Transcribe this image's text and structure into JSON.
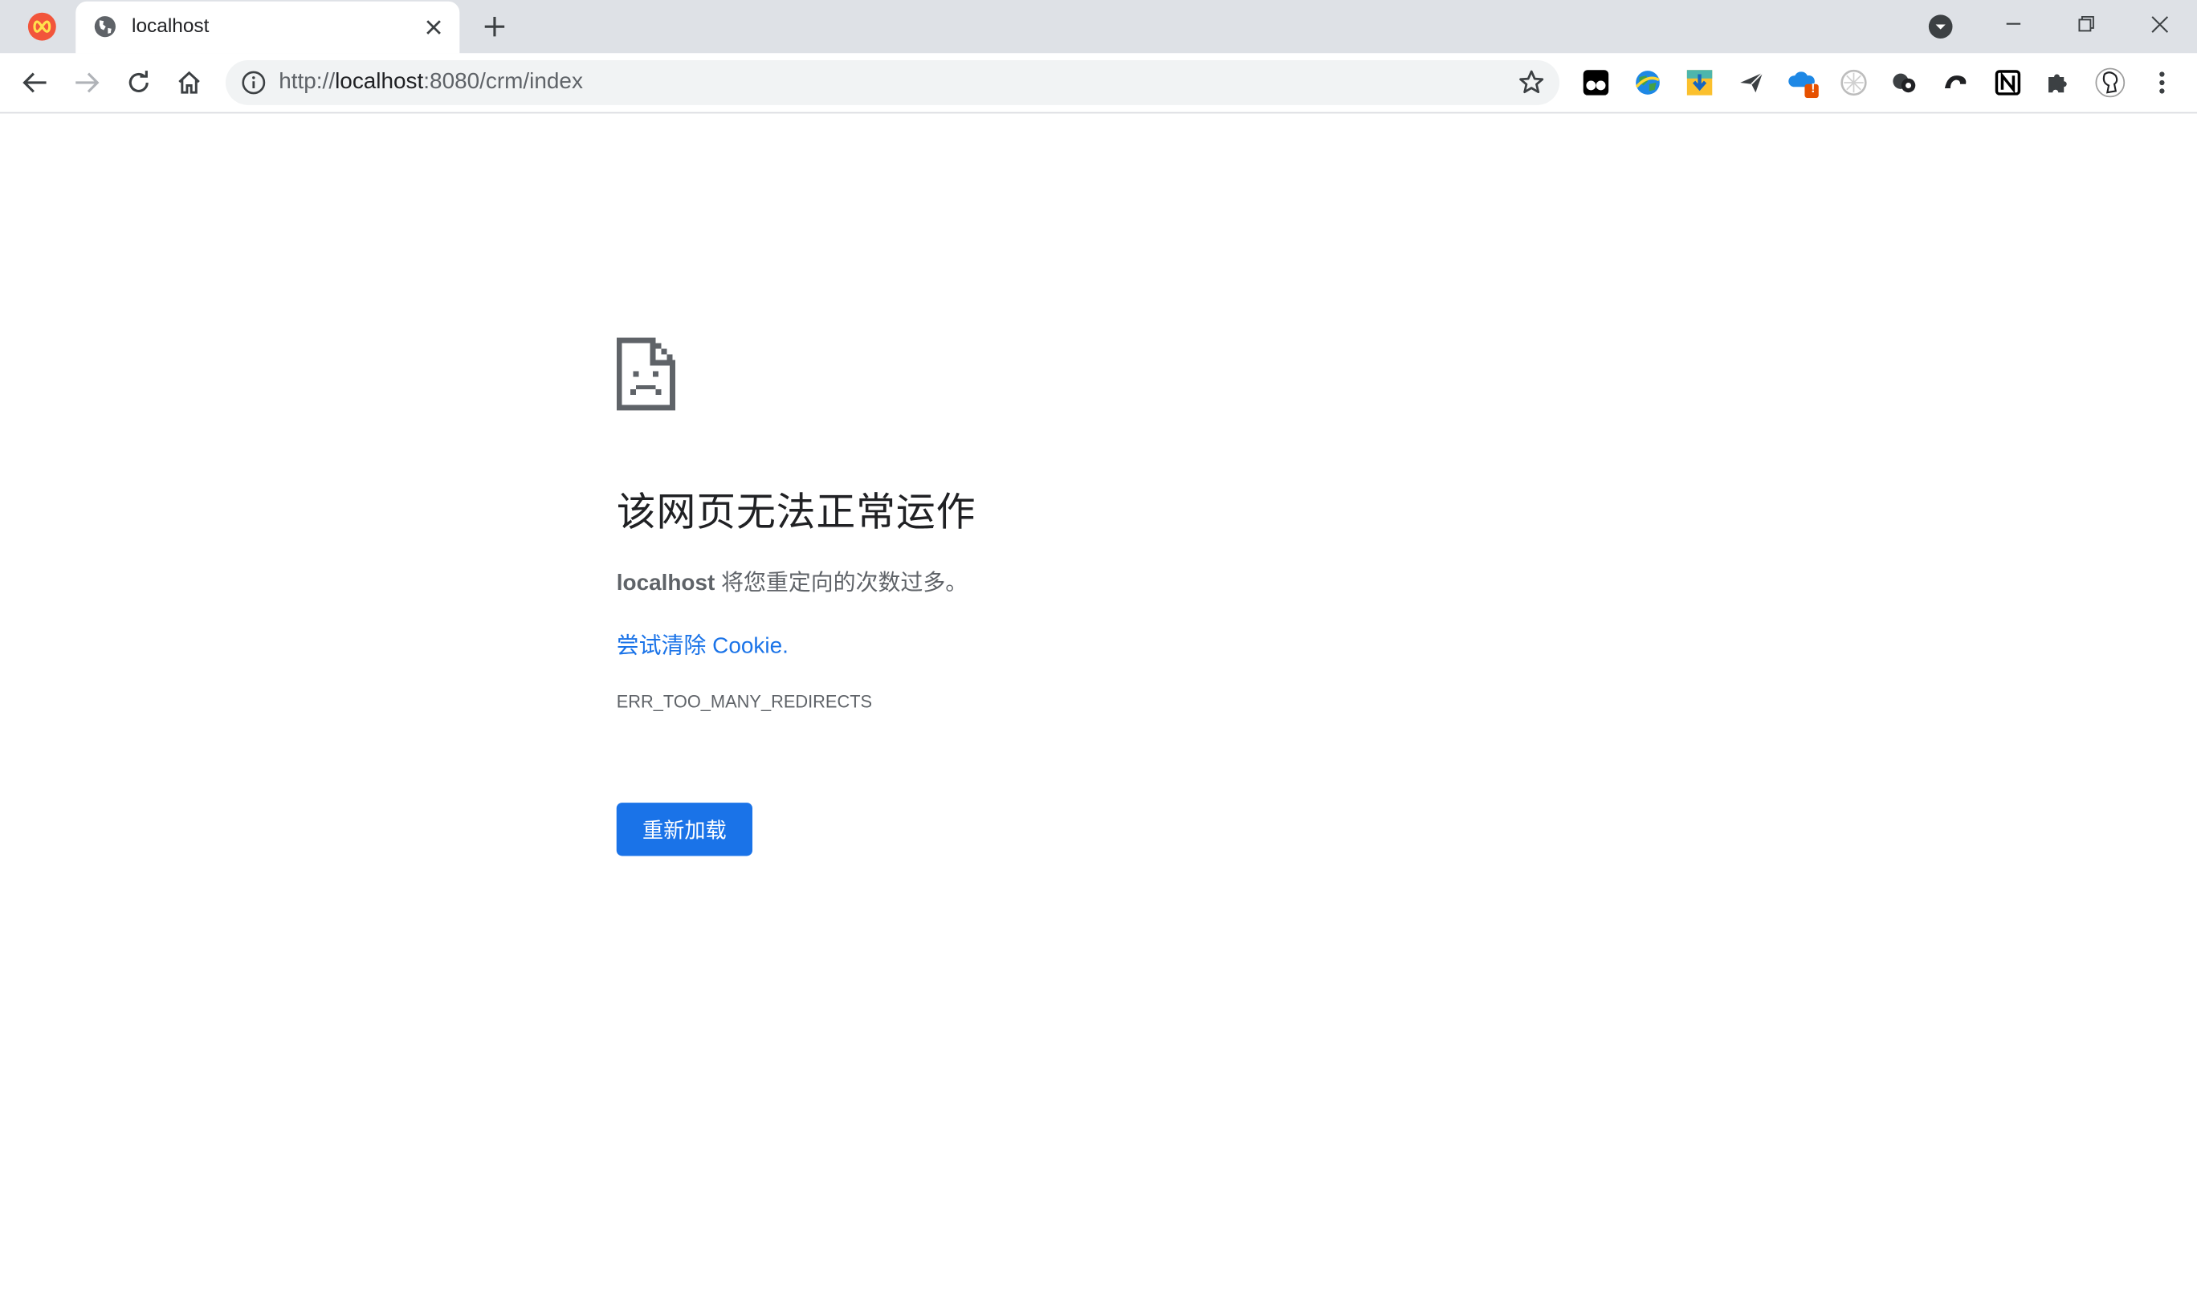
{
  "browser": {
    "tab": {
      "title": "localhost",
      "favicon": "globe-icon"
    },
    "omnibox": {
      "scheme": "http://",
      "host": "localhost",
      "path": ":8080/crm/index"
    },
    "extensions": [
      "tampermonkey-icon",
      "globe-extension-icon",
      "download-extension-icon",
      "send-icon",
      "cloud-warning-icon",
      "grey-circle-extension-icon",
      "dots-extension-icon",
      "hook-extension-icon",
      "notion-icon",
      "puzzle-icon",
      "profile-avatar-icon",
      "more-vert-icon"
    ],
    "extension_badge": "!"
  },
  "error_page": {
    "title": "该网页无法正常运作",
    "description_host": "localhost",
    "description_rest": " 将您重定向的次数过多。",
    "link_text": "尝试清除 Cookie.",
    "error_code": "ERR_TOO_MANY_REDIRECTS",
    "reload_label": "重新加载"
  },
  "colors": {
    "accent": "#1a73e8",
    "tabstrip": "#dee1e6",
    "text": "#202124",
    "secondary_text": "#5f6368"
  }
}
